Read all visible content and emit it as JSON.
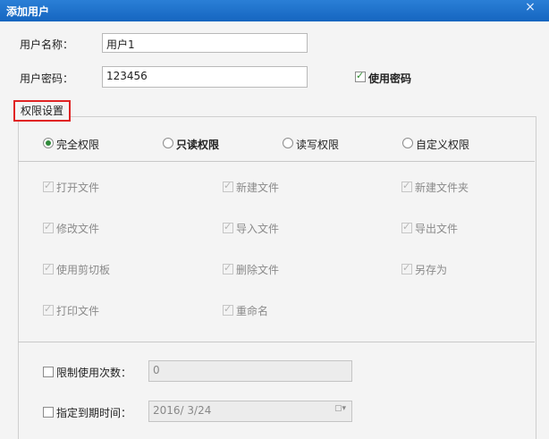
{
  "window": {
    "title": "添加用户",
    "close_symbol": "×"
  },
  "form": {
    "username_label": "用户名称：",
    "username_value": "用户1",
    "password_label": "用户密码：",
    "password_value": "123456",
    "use_password_label": "使用密码",
    "use_password_checked": true
  },
  "permissions": {
    "section_title": "权限设置",
    "modes": [
      {
        "label": "完全权限",
        "selected": true
      },
      {
        "label": "只读权限",
        "selected": false
      },
      {
        "label": "读写权限",
        "selected": false
      },
      {
        "label": "自定义权限",
        "selected": false
      }
    ],
    "items": [
      "打开文件",
      "新建文件",
      "新建文件夹",
      "修改文件",
      "导入文件",
      "导出文件",
      "使用剪切板",
      "删除文件",
      "另存为",
      "打印文件",
      "重命名"
    ]
  },
  "limits": {
    "usage_limit_label": "限制使用次数：",
    "usage_limit_value": "0",
    "expiry_label": "指定到期时间：",
    "expiry_value": "2016/ 3/24",
    "calendar_icon": "calendar-icon"
  }
}
